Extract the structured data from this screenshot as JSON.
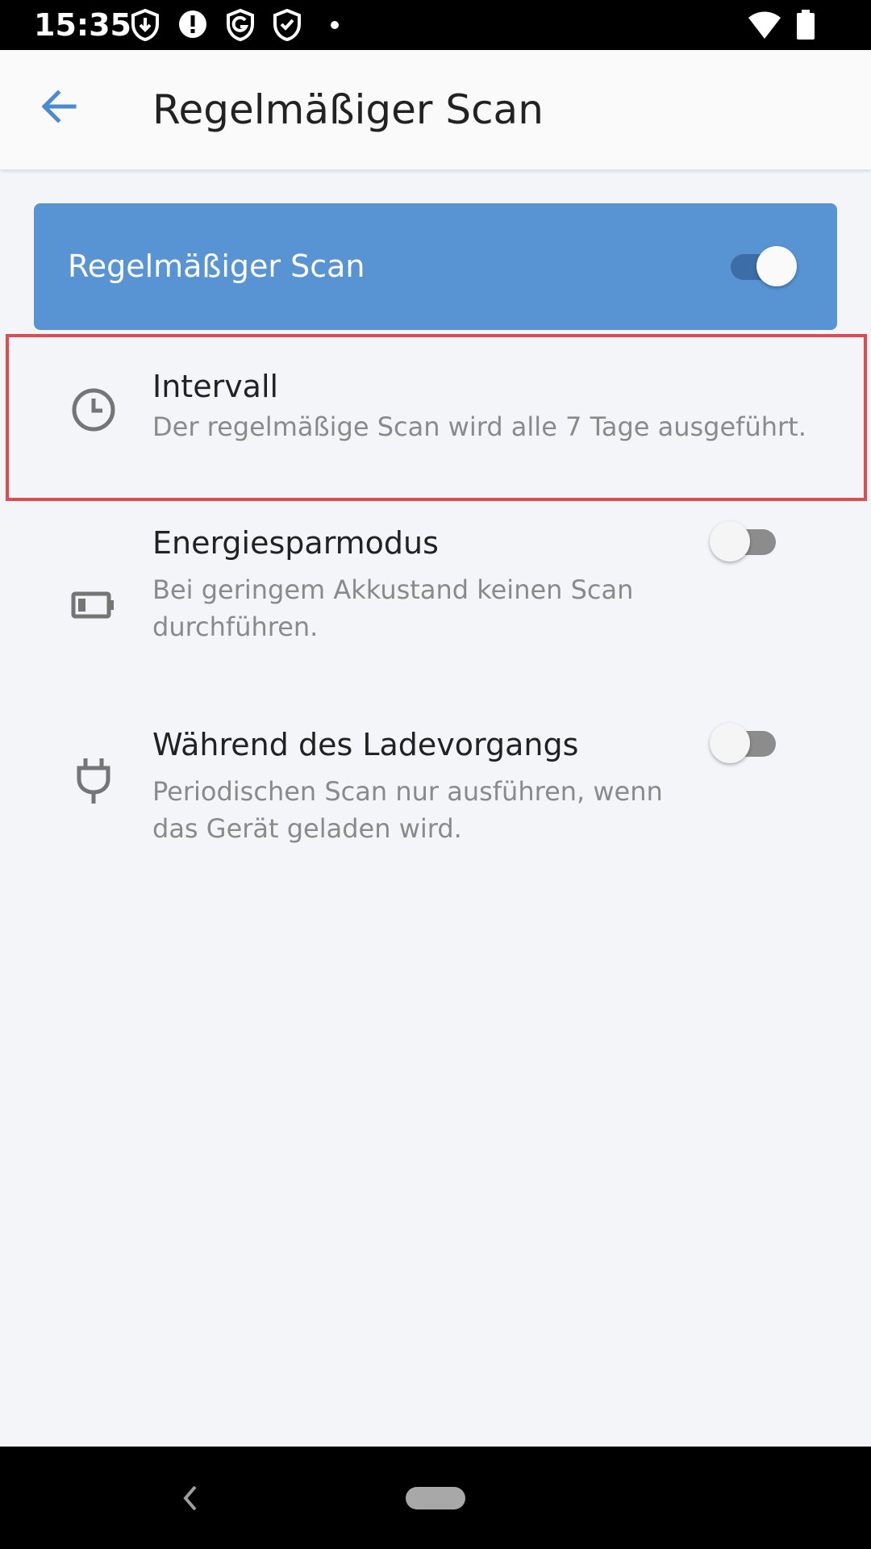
{
  "status_bar": {
    "time": "15:35",
    "left_icons": [
      "shield-download-icon",
      "alert-circle-icon",
      "g-shield-icon",
      "shield-check-icon",
      "dot-icon"
    ],
    "right_icons": [
      "wifi-icon",
      "battery-icon"
    ]
  },
  "app_bar": {
    "title": "Regelmäßiger Scan",
    "back_icon": "arrow-left-icon"
  },
  "master_toggle": {
    "label": "Regelmäßiger Scan",
    "checked": true
  },
  "settings": [
    {
      "icon": "clock-icon",
      "title": "Intervall",
      "description": "Der regelmäßige Scan wird alle 7 Tage ausgeführt."
    },
    {
      "icon": "battery-low-icon",
      "title": "Energiesparmodus",
      "description": "Bei geringem Akkustand keinen Scan durchführen.",
      "checked": false
    },
    {
      "icon": "power-plug-icon",
      "title": "Während des Ladevorgangs",
      "description": "Periodischen Scan nur ausführen, wenn das Gerät geladen wird.",
      "checked": false
    }
  ],
  "colors": {
    "accent": "#5894d4",
    "accent_dark": "#3c6da6",
    "highlight": "#e04b4f",
    "background": "#f4f5f8"
  },
  "nav_bar": {
    "back_icon": "nav-back-icon",
    "home_icon": "nav-home-pill-icon"
  }
}
